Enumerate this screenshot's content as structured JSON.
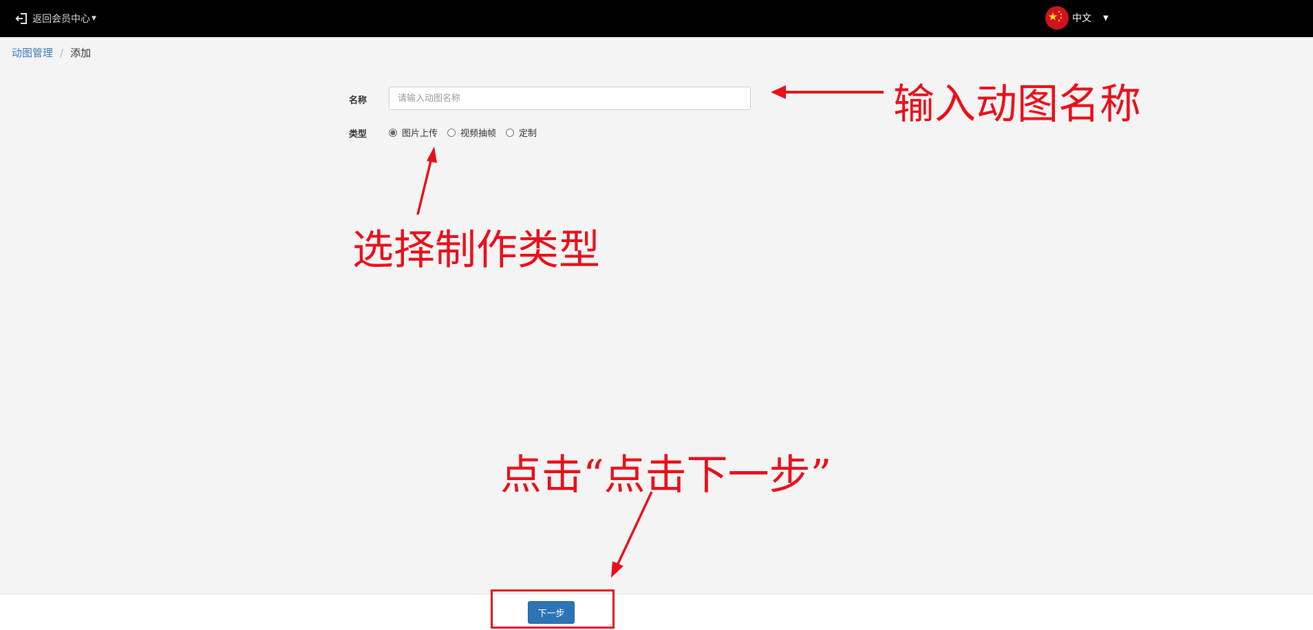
{
  "header": {
    "back_label": "返回会员中心",
    "back_icon": "sign-out-icon",
    "language_label": "中文",
    "language_flag": "china-flag-icon"
  },
  "breadcrumb": {
    "parent": "动图管理",
    "separator": "/",
    "current": "添加"
  },
  "form": {
    "name_label": "名称",
    "name_placeholder": "请输入动图名称",
    "name_value": "",
    "type_label": "类型",
    "type_options": [
      "图片上传",
      "视频抽帧",
      "定制"
    ],
    "type_selected": "图片上传"
  },
  "footer": {
    "next_label": "下一步"
  },
  "annotations": {
    "name_hint": "输入动图名称",
    "type_hint": "选择制作类型",
    "next_hint": "点击“点击下一步”",
    "color": "#e8101a"
  },
  "colors": {
    "topbar": "#000000",
    "page_bg": "#f4f4f4",
    "link": "#3d7ab8",
    "primary_button": "#2d74b5"
  }
}
